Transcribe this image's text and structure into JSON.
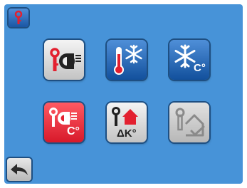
{
  "units": {
    "celsius_label": "C°",
    "delta_k_label": "ΔK°"
  },
  "colors": {
    "screen": "#4793d8",
    "accent_red": "#e3202f",
    "tile_blue": "#1f63b4",
    "tile_grey": "#d8d8d8"
  },
  "icons": {
    "top_left": "sensor-icon",
    "back": "back-arrow-icon",
    "menu": [
      "sensor-fan-icon",
      "heating-thermometer-snowflake-icon",
      "snowflake-celsius-icon",
      "sensor-fan-celsius-icon",
      "sensor-house-delta-icon",
      "sensor-house-check-icon"
    ]
  }
}
